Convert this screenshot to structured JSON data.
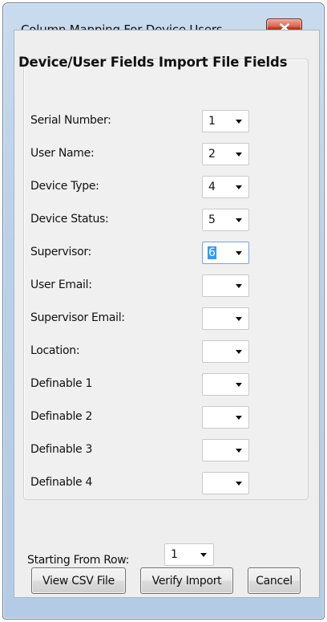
{
  "window": {
    "title": "Column Mapping For Device Users"
  },
  "header": {
    "text": "Device/User Fields Import File Fields"
  },
  "fields": [
    {
      "label": "Serial Number:",
      "value": "1"
    },
    {
      "label": "User Name:",
      "value": "2"
    },
    {
      "label": "Device Type:",
      "value": "4"
    },
    {
      "label": "Device Status:",
      "value": "5"
    },
    {
      "label": "Supervisor:",
      "value": "6"
    },
    {
      "label": "User Email:",
      "value": ""
    },
    {
      "label": "Supervisor Email:",
      "value": ""
    },
    {
      "label": "Location:",
      "value": ""
    },
    {
      "label": "Definable 1",
      "value": ""
    },
    {
      "label": "Definable 2",
      "value": ""
    },
    {
      "label": "Definable 3",
      "value": ""
    },
    {
      "label": "Definable 4",
      "value": ""
    }
  ],
  "starting_row": {
    "label": "Starting From Row:",
    "value": "1"
  },
  "buttons": {
    "view_csv": "View CSV File",
    "verify_import": "Verify Import",
    "cancel": "Cancel"
  },
  "colors": {
    "selection": "#3399ff",
    "close_button": "#c9402a"
  }
}
